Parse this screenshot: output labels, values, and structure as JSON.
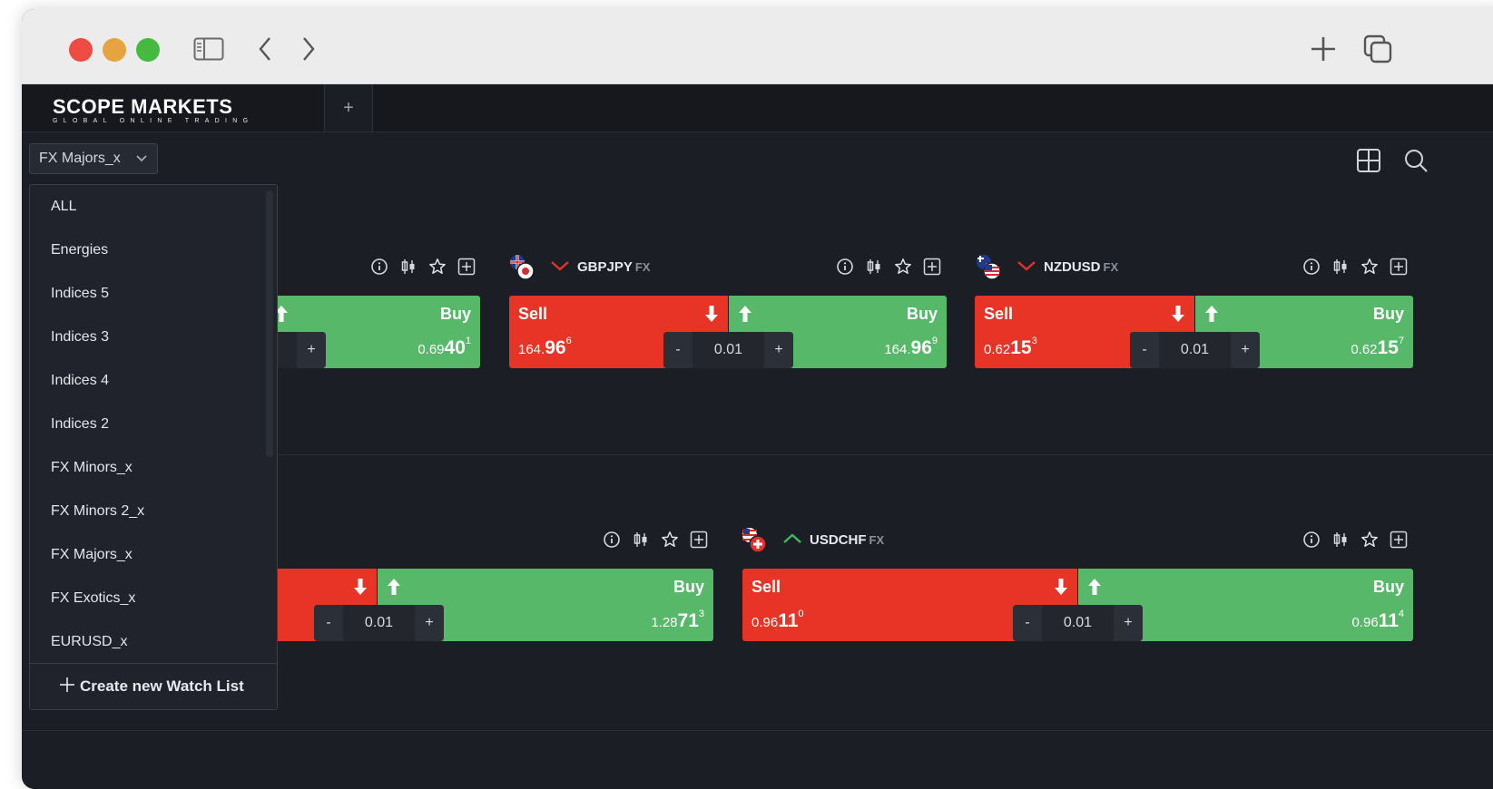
{
  "window": {
    "traffic_lights": [
      "close",
      "minimize",
      "zoom"
    ]
  },
  "tabbar": {
    "logo_main": "SCOPE MARKETS",
    "logo_sub": "GLOBAL ONLINE TRADING",
    "add_tab": "+"
  },
  "watchlist": {
    "selected": "FX Majors_x",
    "options": [
      "ALL",
      "Energies",
      "Indices 5",
      "Indices 3",
      "Indices 4",
      "Indices 2",
      "FX Minors_x",
      "FX Minors 2_x",
      "FX Majors_x",
      "FX Exotics_x",
      "EURUSD_x"
    ],
    "create_label": "Create new Watch List"
  },
  "cards": [
    {
      "id": "row1-partial",
      "sell_label": "",
      "buy_label": "Buy",
      "sell_price": {
        "pre": "",
        "big": "",
        "sup": ""
      },
      "buy_price": {
        "pre": "0.69",
        "big": "40",
        "sup": "1"
      },
      "qty": ""
    },
    {
      "id": "gbpjpy",
      "symbol": "GBPJPY",
      "market": "FX",
      "trend": "down",
      "sell_label": "Sell",
      "buy_label": "Buy",
      "sell_price": {
        "pre": "164.",
        "big": "96",
        "sup": "6"
      },
      "buy_price": {
        "pre": "164.",
        "big": "96",
        "sup": "9"
      },
      "qty": "0.01"
    },
    {
      "id": "nzdusd",
      "symbol": "NZDUSD",
      "market": "FX",
      "trend": "down",
      "sell_label": "Sell",
      "buy_label": "Buy",
      "sell_price": {
        "pre": "0.62",
        "big": "15",
        "sup": "3"
      },
      "buy_price": {
        "pre": "0.62",
        "big": "15",
        "sup": "7"
      },
      "qty": "0.01"
    },
    {
      "id": "row2-partial",
      "sell_label": "",
      "buy_label": "Buy",
      "sell_price": {
        "pre": "",
        "big": "",
        "sup": ""
      },
      "buy_price": {
        "pre": "1.28",
        "big": "71",
        "sup": "3"
      },
      "qty": "0.01"
    },
    {
      "id": "usdchf",
      "symbol": "USDCHF",
      "market": "FX",
      "trend": "up",
      "sell_label": "Sell",
      "buy_label": "Buy",
      "sell_price": {
        "pre": "0.96",
        "big": "11",
        "sup": "0"
      },
      "buy_price": {
        "pre": "0.96",
        "big": "11",
        "sup": "4"
      },
      "qty": "0.01"
    }
  ],
  "stepper": {
    "minus": "-",
    "plus": "+"
  },
  "colors": {
    "sell": "#e73426",
    "buy": "#58b86a",
    "trend_down": "#e0332b",
    "trend_up": "#3cba61",
    "background": "#1b1e25"
  }
}
